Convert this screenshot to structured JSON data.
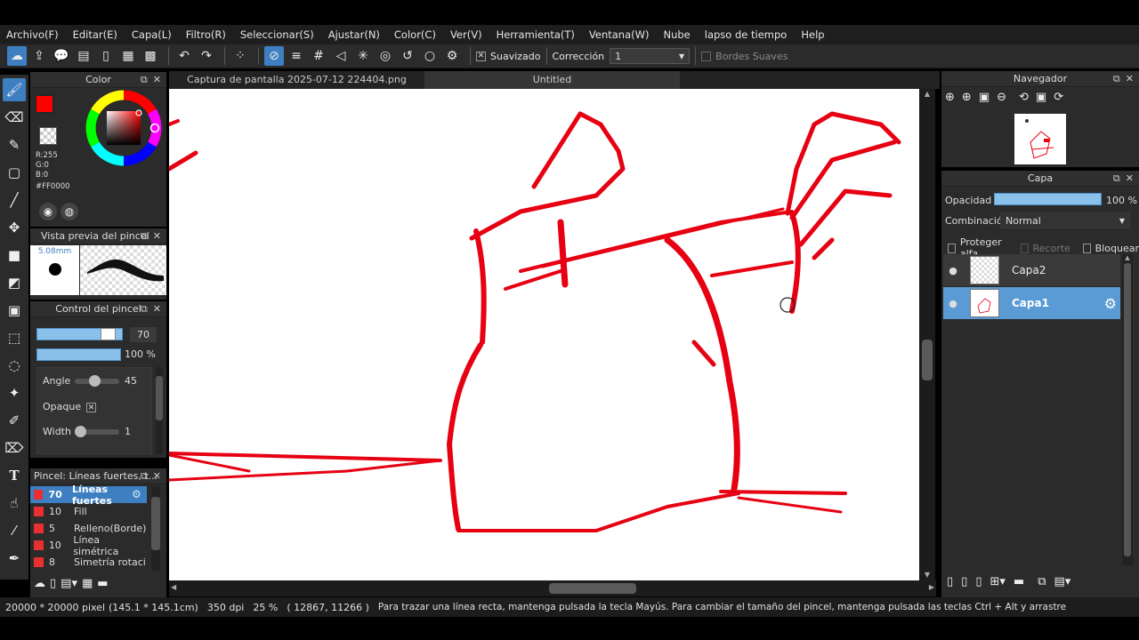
{
  "menu": [
    "Archivo(F)",
    "Editar(E)",
    "Capa(L)",
    "Filtro(R)",
    "Seleccionar(S)",
    "Ajustar(N)",
    "Color(C)",
    "Ver(V)",
    "Herramienta(T)",
    "Ventana(W)",
    "Nube",
    "lapso de tiempo",
    "Help"
  ],
  "toolbar": {
    "smoothing_label": "Suavizado",
    "correction_label": "Corrección",
    "correction_value": "1",
    "soft_edges_label": "Bordes Suaves"
  },
  "color_panel": {
    "title": "Color",
    "r": "R:255",
    "g": "G:0",
    "b": "B:0",
    "hex": "#FF0000",
    "main_color": "#ff0000"
  },
  "brush_preview": {
    "title": "Vista previa del pincel",
    "size": "5.08mm"
  },
  "brush_control": {
    "title": "Control del pincel",
    "size_value": "70",
    "size_fraction": 0.85,
    "opacity_value": "100 %",
    "opacity_fraction": 1.0,
    "angle_label": "Angle",
    "angle_value": "45",
    "opaque_label": "Opaque",
    "width_label": "Width",
    "width_value": "1"
  },
  "brush_list": {
    "title": "Pincel: Líneas fuertes, t...",
    "items": [
      {
        "size": "70",
        "name": "Líneas fuertes"
      },
      {
        "size": "10",
        "name": "Fill"
      },
      {
        "size": "5",
        "name": "Relleno(Borde)"
      },
      {
        "size": "10",
        "name": "Línea simétrica"
      },
      {
        "size": "8",
        "name": "Simetría rotacio"
      }
    ]
  },
  "tabs": {
    "tab1": "Captura de pantalla 2025-07-12 224404.png",
    "tab2": "Untitled"
  },
  "navigator": {
    "title": "Navegador"
  },
  "layers_panel": {
    "title": "Capa",
    "opacity_label": "Opacidad",
    "opacity_value": "100 %",
    "blend_label": "Combinación",
    "blend_value": "Normal",
    "protect_alpha": "Proteger alfa",
    "clip": "Recorte",
    "lock": "Bloquear",
    "layers": [
      {
        "name": "Capa2",
        "selected": false
      },
      {
        "name": "Capa1",
        "selected": true
      }
    ]
  },
  "status": {
    "canvas_size": "20000 * 20000 pixel",
    "physical_size": "(145.1 * 145.1cm)",
    "dpi": "350 dpi",
    "zoom": "25 %",
    "coords": "( 12867, 11266 )",
    "hint": "Para trazar una línea recta, mantenga pulsada la tecla Mayús. Para cambiar el tamaño del pincel, mantenga pulsada las teclas Ctrl + Alt y arrastre"
  },
  "colors": {
    "accent": "#3d7fc1",
    "stroke": "#e60012",
    "panel": "#2b2b2b"
  }
}
